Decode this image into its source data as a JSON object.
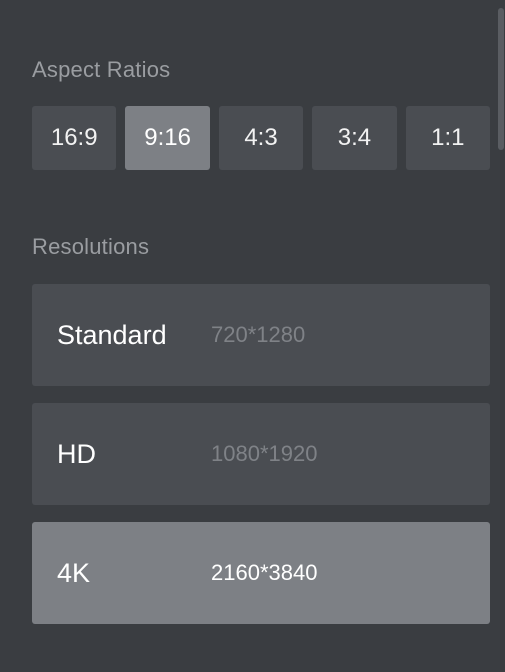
{
  "aspect_ratios": {
    "title": "Aspect Ratios",
    "options": [
      "16:9",
      "9:16",
      "4:3",
      "3:4",
      "1:1"
    ],
    "selected": "9:16"
  },
  "resolutions": {
    "title": "Resolutions",
    "items": [
      {
        "name": "Standard",
        "value": "720*1280"
      },
      {
        "name": "HD",
        "value": "1080*1920"
      },
      {
        "name": "4K",
        "value": "2160*3840"
      }
    ],
    "selected": "4K"
  },
  "colors": {
    "background": "#3a3d41",
    "button": "#4a4d52",
    "selected": "#7d8085",
    "muted_text": "#9a9da1"
  }
}
